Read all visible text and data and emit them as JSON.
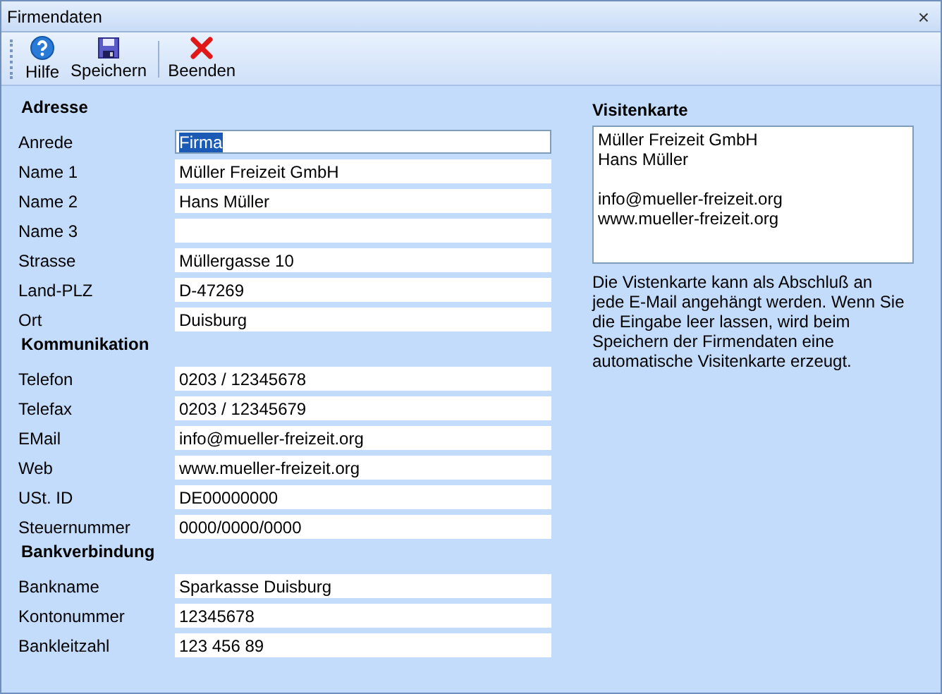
{
  "window": {
    "title": "Firmendaten",
    "close": "×"
  },
  "toolbar": [
    {
      "label": "Hilfe",
      "kind": "help"
    },
    {
      "label": "Speichern",
      "kind": "save"
    },
    {
      "label": "Beenden",
      "kind": "close"
    }
  ],
  "sections": [
    {
      "title": "Adresse",
      "fields": [
        {
          "label": "Anrede",
          "value": "Firma",
          "focused": true
        },
        {
          "label": "Name 1",
          "value": "Müller Freizeit GmbH",
          "focused": false
        },
        {
          "label": "Name 2",
          "value": "Hans Müller",
          "focused": false
        },
        {
          "label": "Name 3",
          "focused": false
        },
        {
          "label": "Strasse",
          "value": "Müllergasse 10",
          "focused": false
        },
        {
          "label": "Land-PLZ",
          "value": "D-47269",
          "focused": false
        },
        {
          "label": "Ort",
          "value": "Duisburg",
          "focused": false
        }
      ]
    },
    {
      "title": "Kommunikation",
      "fields": [
        {
          "label": "Telefon",
          "value": "0203 / 12345678",
          "focused": false
        },
        {
          "label": "Telefax",
          "value": "0203 / 12345679",
          "focused": false
        },
        {
          "label": "EMail",
          "value": "info@mueller-freizeit.org",
          "focused": false
        },
        {
          "label": "Web",
          "value": "www.mueller-freizeit.org",
          "focused": false
        },
        {
          "label": "USt. ID",
          "value": "DE00000000",
          "focused": false
        },
        {
          "label": "Steuernummer",
          "value": "0000/0000/0000",
          "focused": false
        }
      ]
    },
    {
      "title": "Bankverbindung",
      "fields": [
        {
          "label": "Bankname",
          "value": "Sparkasse Duisburg",
          "focused": false
        },
        {
          "label": "Kontonummer",
          "value": "12345678",
          "focused": false
        },
        {
          "label": "Bankleitzahl",
          "value": "123 456 89",
          "focused": false
        }
      ]
    }
  ],
  "visitenkarte": {
    "title": "Visitenkarte",
    "value": "Müller Freizeit GmbH\nHans Müller\n\ninfo@mueller-freizeit.org\nwww.mueller-freizeit.org",
    "note": "Die Vistenkarte kann als Abschluß an jede E-Mail angehängt werden. Wenn Sie die Eingabe leer lassen, wird beim Speichern der Firmendaten eine automatische Visitenkarte erzeugt."
  }
}
